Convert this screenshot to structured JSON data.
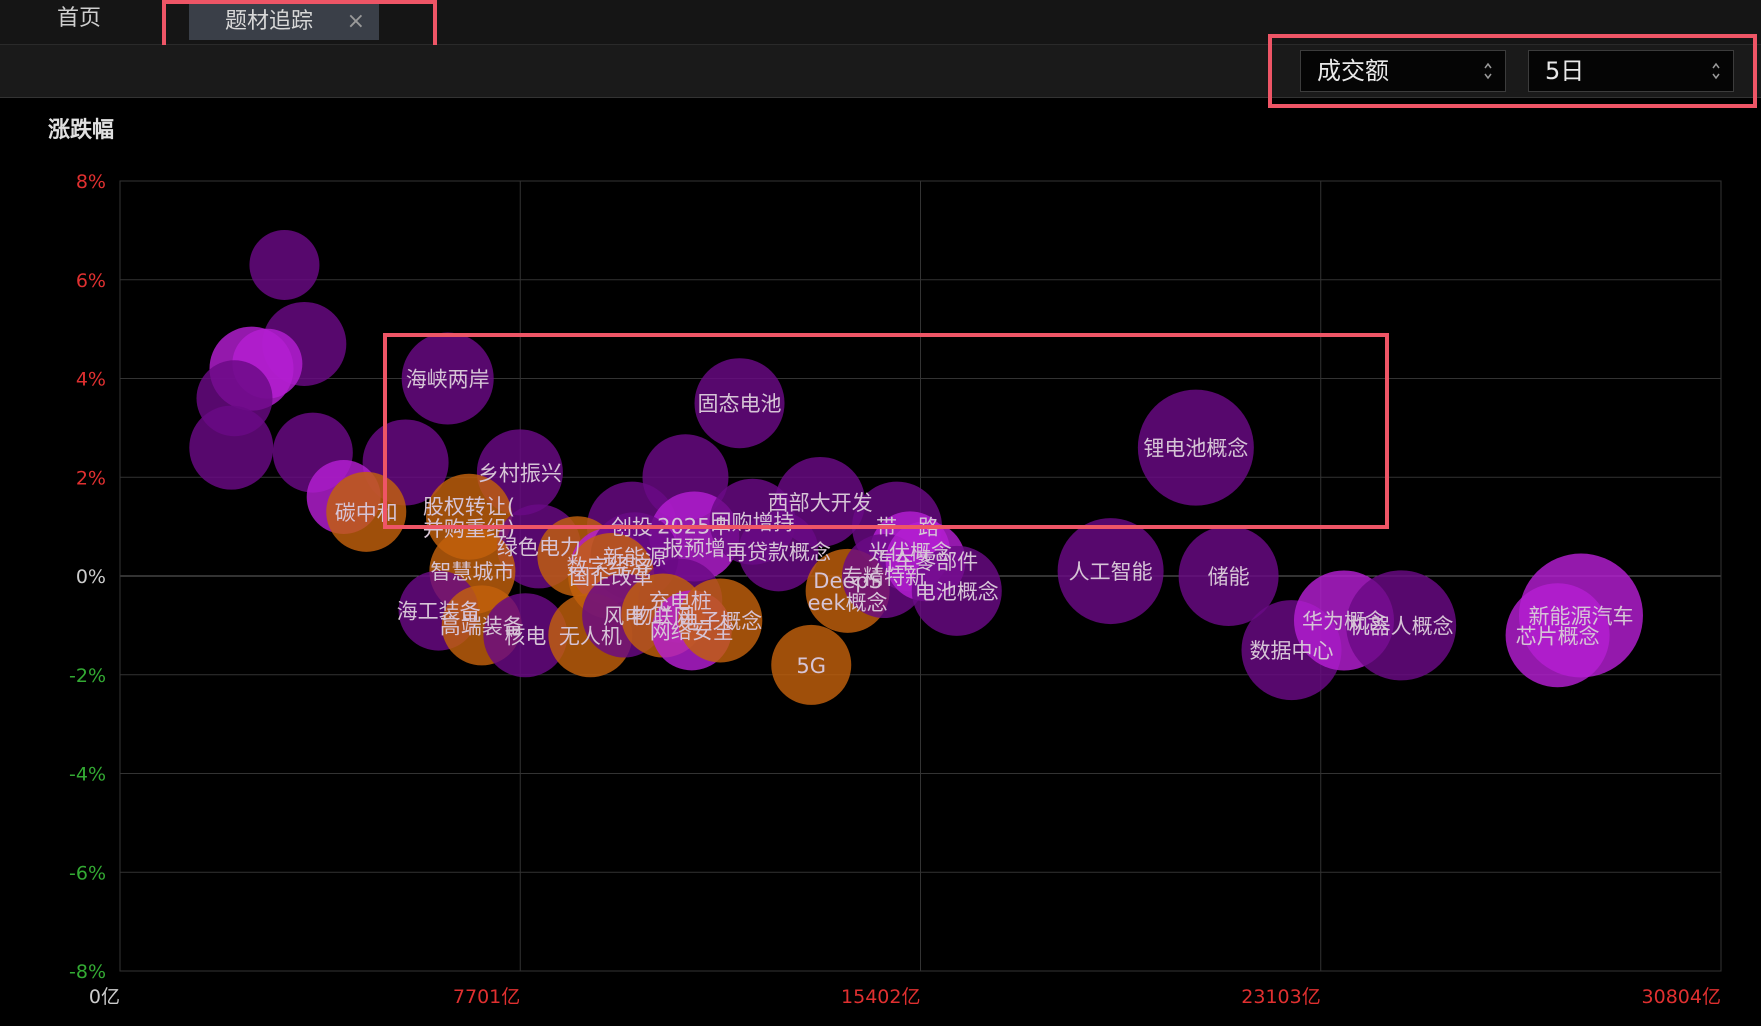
{
  "tabs": {
    "home": "首页",
    "active": "题材追踪",
    "close_glyph": "×"
  },
  "controls": {
    "metric": "成交额",
    "period": "5日"
  },
  "chart_data": {
    "type": "scatter",
    "subtype": "bubble",
    "ylabel": "涨跌幅",
    "xlabel": "",
    "xlim": [
      0,
      30804
    ],
    "ylim": [
      -8,
      8
    ],
    "x_ticks": [
      "0亿",
      "7701亿",
      "15402亿",
      "23103亿",
      "30804亿"
    ],
    "y_ticks": [
      "8%",
      "6%",
      "4%",
      "2%",
      "0%",
      "-2%",
      "-4%",
      "-6%",
      "-8%"
    ],
    "grid": true,
    "colors": {
      "purple": "#6a0a85",
      "magenta": "#b41ed2",
      "orange": "#c2600c",
      "positive": "#e03030",
      "negative": "#33aa33",
      "label": "#d6c4d6"
    },
    "points": [
      {
        "label": "",
        "x": 3164,
        "y": 6.3,
        "size": 35,
        "color": "purple"
      },
      {
        "label": "",
        "x": 3546,
        "y": 4.7,
        "size": 42,
        "color": "purple"
      },
      {
        "label": "",
        "x": 2530,
        "y": 4.2,
        "size": 42,
        "color": "magenta"
      },
      {
        "label": "",
        "x": 2835,
        "y": 4.3,
        "size": 35,
        "color": "magenta"
      },
      {
        "label": "",
        "x": 2203,
        "y": 3.6,
        "size": 38,
        "color": "purple"
      },
      {
        "label": "",
        "x": 2141,
        "y": 2.6,
        "size": 42,
        "color": "purple"
      },
      {
        "label": "",
        "x": 3710,
        "y": 2.5,
        "size": 40,
        "color": "purple"
      },
      {
        "label": "",
        "x": 5495,
        "y": 2.3,
        "size": 43,
        "color": "purple"
      },
      {
        "label": "",
        "x": 4304,
        "y": 1.6,
        "size": 37,
        "color": "magenta"
      },
      {
        "label": "海峡两岸",
        "x": 6305,
        "y": 4.0,
        "size": 46,
        "color": "purple"
      },
      {
        "label": "固态电池",
        "x": 11920,
        "y": 3.5,
        "size": 45,
        "color": "purple"
      },
      {
        "label": "锂电池概念",
        "x": 20700,
        "y": 2.6,
        "size": 58,
        "color": "purple"
      },
      {
        "label": "乡村振兴",
        "x": 7694,
        "y": 2.1,
        "size": 43,
        "color": "purple"
      },
      {
        "label": "碳中和",
        "x": 4738,
        "y": 1.3,
        "size": 40,
        "color": "orange"
      },
      {
        "label": "股权转让(并购重组)",
        "x": 6715,
        "y": 1.2,
        "size": 43,
        "color": "orange"
      },
      {
        "label": "",
        "x": 10880,
        "y": 2.0,
        "size": 43,
        "color": "purple"
      },
      {
        "label": "西部大开发",
        "x": 13470,
        "y": 1.5,
        "size": 45,
        "color": "purple"
      },
      {
        "label": "创投",
        "x": 9850,
        "y": 1.0,
        "size": 45,
        "color": "purple"
      },
      {
        "label": "2025中报预增",
        "x": 11050,
        "y": 0.8,
        "size": 45,
        "color": "magenta"
      },
      {
        "label": "回购增持",
        "x": 12170,
        "y": 1.1,
        "size": 43,
        "color": "purple"
      },
      {
        "label": "绿色电力",
        "x": 8060,
        "y": 0.6,
        "size": 42,
        "color": "purple"
      },
      {
        "label": "智慧城市",
        "x": 6780,
        "y": 0.1,
        "size": 43,
        "color": "orange"
      },
      {
        "label": "",
        "x": 8800,
        "y": 0.4,
        "size": 40,
        "color": "orange"
      },
      {
        "label": "数字经济",
        "x": 9400,
        "y": 0.2,
        "size": 38,
        "color": "magenta"
      },
      {
        "label": "新能源",
        "x": 9900,
        "y": 0.4,
        "size": 44,
        "color": "purple"
      },
      {
        "label": "再贷款概念",
        "x": 12670,
        "y": 0.5,
        "size": 40,
        "color": "purple"
      },
      {
        "label": "国企改革",
        "x": 9450,
        "y": 0.0,
        "size": 43,
        "color": "orange"
      },
      {
        "label": "一带一路",
        "x": 14950,
        "y": 1.0,
        "size": 45,
        "color": "purple"
      },
      {
        "label": "光伏概念",
        "x": 15200,
        "y": 0.5,
        "size": 40,
        "color": "magenta"
      },
      {
        "label": "DeepSeek概念",
        "x": 14000,
        "y": -0.3,
        "size": 42,
        "color": "orange"
      },
      {
        "label": "专精特新",
        "x": 14700,
        "y": 0.0,
        "size": 42,
        "color": "purple"
      },
      {
        "label": "汽车零部件",
        "x": 15500,
        "y": 0.3,
        "size": 40,
        "color": "magenta"
      },
      {
        "label": "电池概念",
        "x": 16100,
        "y": -0.3,
        "size": 45,
        "color": "purple"
      },
      {
        "label": "人工智能",
        "x": 19060,
        "y": 0.1,
        "size": 53,
        "color": "purple"
      },
      {
        "label": "储能",
        "x": 21330,
        "y": 0.0,
        "size": 50,
        "color": "purple"
      },
      {
        "label": "海工装备",
        "x": 6130,
        "y": -0.7,
        "size": 40,
        "color": "purple"
      },
      {
        "label": "高端装备",
        "x": 6960,
        "y": -1.0,
        "size": 40,
        "color": "orange"
      },
      {
        "label": "充电桩",
        "x": 10780,
        "y": -0.5,
        "size": 42,
        "color": "purple"
      },
      {
        "label": "核电",
        "x": 7800,
        "y": -1.2,
        "size": 42,
        "color": "purple"
      },
      {
        "label": "无人机",
        "x": 9050,
        "y": -1.2,
        "size": 42,
        "color": "orange"
      },
      {
        "label": "风电",
        "x": 9700,
        "y": -0.8,
        "size": 42,
        "color": "purple"
      },
      {
        "label": "物联网",
        "x": 10450,
        "y": -0.8,
        "size": 42,
        "color": "orange"
      },
      {
        "label": "网络安全",
        "x": 11000,
        "y": -1.1,
        "size": 40,
        "color": "magenta"
      },
      {
        "label": "电子概念",
        "x": 11550,
        "y": -0.9,
        "size": 42,
        "color": "orange"
      },
      {
        "label": "5G",
        "x": 13300,
        "y": -1.8,
        "size": 40,
        "color": "orange"
      },
      {
        "label": "数据中心",
        "x": 22540,
        "y": -1.5,
        "size": 50,
        "color": "purple"
      },
      {
        "label": "华为概念",
        "x": 23550,
        "y": -0.9,
        "size": 50,
        "color": "magenta"
      },
      {
        "label": "机器人概念",
        "x": 24650,
        "y": -1.0,
        "size": 55,
        "color": "purple"
      },
      {
        "label": "新能源汽车",
        "x": 28110,
        "y": -0.8,
        "size": 62,
        "color": "magenta"
      },
      {
        "label": "芯片概念",
        "x": 27660,
        "y": -1.2,
        "size": 52,
        "color": "magenta"
      }
    ]
  }
}
